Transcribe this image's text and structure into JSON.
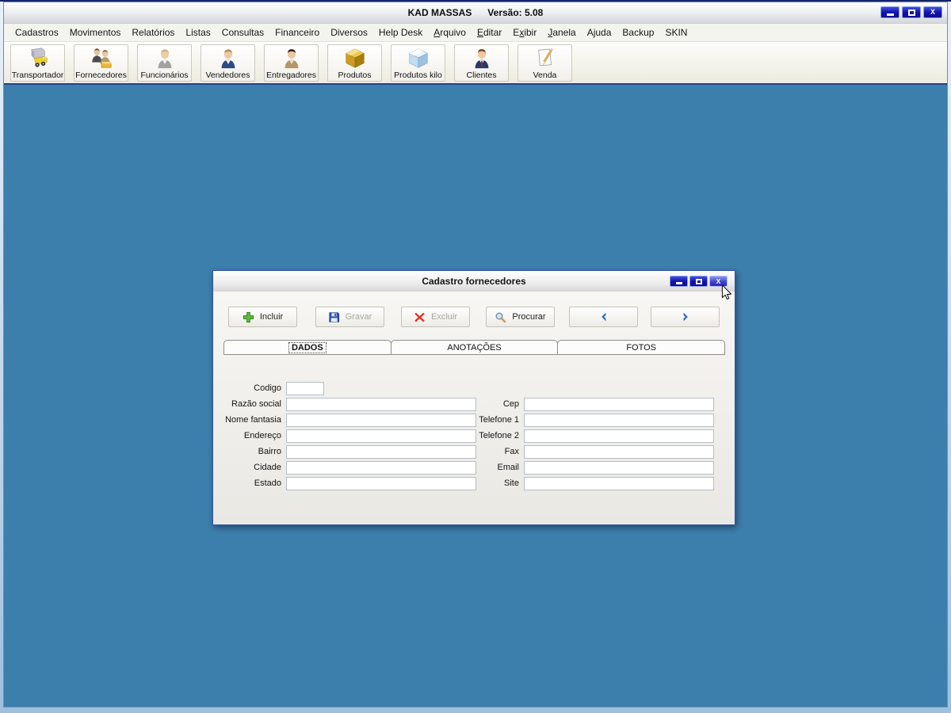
{
  "window": {
    "title_app": "KAD MASSAS",
    "title_version": "Versão: 5.08",
    "close_glyph": "X"
  },
  "menu": {
    "items": [
      {
        "label": "Cadastros"
      },
      {
        "label": "Movimentos"
      },
      {
        "label": "Relatórios"
      },
      {
        "label": "Listas"
      },
      {
        "label": "Consultas"
      },
      {
        "label": "Financeiro"
      },
      {
        "label": "Diversos"
      },
      {
        "label": "Help Desk"
      },
      {
        "label": "Arquivo",
        "accel": 0
      },
      {
        "label": "Editar",
        "accel": 0
      },
      {
        "label": "Exibir",
        "accel": 1
      },
      {
        "label": "Janela",
        "accel": 0
      },
      {
        "label": "Ajuda"
      },
      {
        "label": "Backup"
      },
      {
        "label": "SKIN"
      }
    ]
  },
  "toolbar": {
    "items": [
      {
        "label": "Transportador",
        "icon": "truck-icon"
      },
      {
        "label": "Fornecedores",
        "icon": "suppliers-icon"
      },
      {
        "label": "Funcionários",
        "icon": "employee-icon"
      },
      {
        "label": "Vendedores",
        "icon": "salesperson-icon"
      },
      {
        "label": "Entregadores",
        "icon": "courier-icon"
      },
      {
        "label": "Produtos",
        "icon": "product-box-icon"
      },
      {
        "label": "Produtos kilo",
        "icon": "product-kilo-box-icon"
      },
      {
        "label": "Clientes",
        "icon": "client-icon"
      },
      {
        "label": "Venda",
        "icon": "sale-pencil-icon"
      }
    ]
  },
  "dialog": {
    "title": "Cadastro fornecedores",
    "actions": [
      {
        "name": "incluir",
        "label": "Incluir",
        "icon": "plus-icon",
        "enabled": true
      },
      {
        "name": "gravar",
        "label": "Gravar",
        "icon": "save-icon",
        "enabled": false
      },
      {
        "name": "excluir",
        "label": "Excluir",
        "icon": "delete-x-icon",
        "enabled": false
      },
      {
        "name": "procurar",
        "label": "Procurar",
        "icon": "search-icon",
        "enabled": true
      },
      {
        "name": "previous",
        "label": "",
        "icon": "chevron-left-icon",
        "enabled": true
      },
      {
        "name": "next",
        "label": "",
        "icon": "chevron-right-icon",
        "enabled": true
      }
    ],
    "tabs": [
      {
        "label": "DADOS",
        "active": true
      },
      {
        "label": "ANOTAÇÕES",
        "active": false
      },
      {
        "label": "FOTOS",
        "active": false
      }
    ],
    "form": {
      "left": [
        {
          "label": "Codigo",
          "value": "",
          "row": 0,
          "small": true
        },
        {
          "label": "Razão social",
          "value": "",
          "row": 1
        },
        {
          "label": "Nome fantasia",
          "value": "",
          "row": 2
        },
        {
          "label": "Endereço",
          "value": "",
          "row": 3
        },
        {
          "label": "Bairro",
          "value": "",
          "row": 4
        },
        {
          "label": "Cidade",
          "value": "",
          "row": 5
        },
        {
          "label": "Estado",
          "value": "",
          "row": 6
        }
      ],
      "right": [
        {
          "label": "Cep",
          "value": "",
          "row": 1
        },
        {
          "label": "Telefone 1",
          "value": "",
          "row": 2
        },
        {
          "label": "Telefone 2",
          "value": "",
          "row": 3
        },
        {
          "label": "Fax",
          "value": "",
          "row": 4
        },
        {
          "label": "Email",
          "value": "",
          "row": 5
        },
        {
          "label": "Site",
          "value": "",
          "row": 6
        }
      ]
    }
  },
  "colors": {
    "mdi_background": "#3c7eac",
    "window_button": "#1414a8",
    "toolbar_underline": "#2b3f8e",
    "dialog_border": "#33539e"
  }
}
